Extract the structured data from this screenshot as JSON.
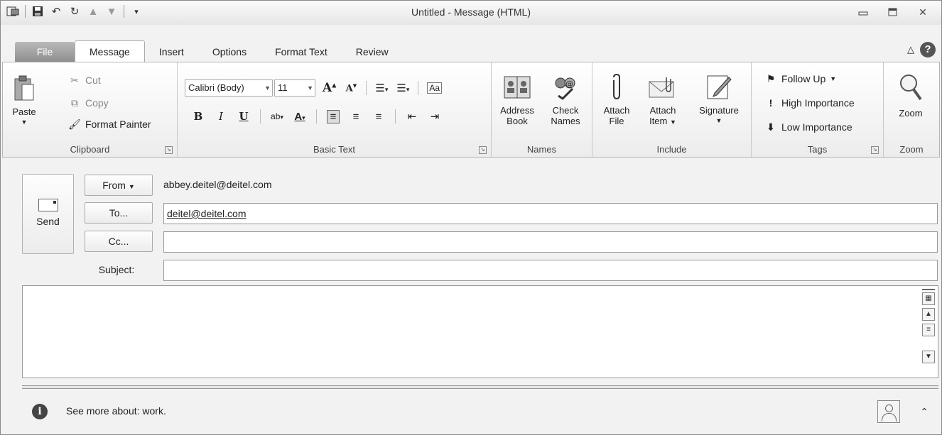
{
  "window": {
    "title": "Untitled - Message (HTML)"
  },
  "qat": {
    "icons": [
      "outlook-icon",
      "save-icon",
      "undo-icon",
      "redo-icon",
      "up-arrow-icon",
      "down-arrow-icon",
      "customize-icon"
    ]
  },
  "tabs": {
    "file": "File",
    "message": "Message",
    "insert": "Insert",
    "options": "Options",
    "format_text": "Format Text",
    "review": "Review"
  },
  "ribbon": {
    "clipboard": {
      "label": "Clipboard",
      "paste": "Paste",
      "cut": "Cut",
      "copy": "Copy",
      "format_painter": "Format Painter"
    },
    "basic_text": {
      "label": "Basic Text",
      "font": "Calibri (Body)",
      "size": "11",
      "bold": "B",
      "italic": "I",
      "underline": "U"
    },
    "names": {
      "label": "Names",
      "address_book_1": "Address",
      "address_book_2": "Book",
      "check_names_1": "Check",
      "check_names_2": "Names"
    },
    "include": {
      "label": "Include",
      "attach_file_1": "Attach",
      "attach_file_2": "File",
      "attach_item_1": "Attach",
      "attach_item_2": "Item",
      "signature": "Signature"
    },
    "tags": {
      "label": "Tags",
      "follow_up": "Follow Up",
      "high_importance": "High Importance",
      "low_importance": "Low Importance"
    },
    "zoom": {
      "label": "Zoom",
      "zoom": "Zoom"
    }
  },
  "compose": {
    "send": "Send",
    "from_label": "From",
    "from_value": "abbey.deitel@deitel.com",
    "to_label": "To...",
    "to_value": "deitel@deitel.com",
    "cc_label": "Cc...",
    "cc_value": "",
    "subject_label": "Subject:",
    "subject_value": "",
    "body": ""
  },
  "people_pane": {
    "text": "See more about: work."
  }
}
